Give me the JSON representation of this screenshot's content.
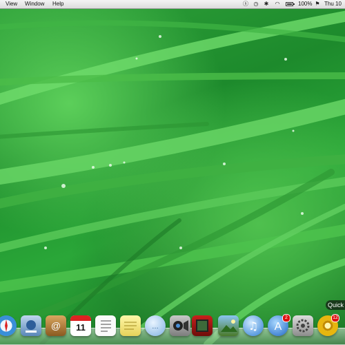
{
  "menubar": {
    "items": [
      "View",
      "Window",
      "Help"
    ],
    "status": {
      "battery_label": "100%",
      "battery_level": 1.0,
      "clock": "Thu 10"
    },
    "icons": [
      "skype-icon",
      "timemachine-icon",
      "bluetooth-icon",
      "wifi-icon",
      "volume-icon",
      "flag-icon"
    ]
  },
  "dock": {
    "items": [
      {
        "name": "safari-icon"
      },
      {
        "name": "preview-icon"
      },
      {
        "name": "address-book-icon"
      },
      {
        "name": "ical-icon",
        "label": "11"
      },
      {
        "name": "textedit-icon"
      },
      {
        "name": "stickies-icon"
      },
      {
        "name": "ichat-icon"
      },
      {
        "name": "facetime-icon"
      },
      {
        "name": "photo-booth-icon"
      },
      {
        "name": "iphoto-icon"
      },
      {
        "name": "itunes-icon"
      },
      {
        "name": "app-store-icon",
        "badge": "2"
      },
      {
        "name": "system-preferences-icon"
      },
      {
        "name": "quicktime-icon",
        "badge": "12"
      }
    ],
    "tooltip": "Quick"
  },
  "colors": {
    "menubar": "#eaeaea",
    "grass_light": "#5ccf5a",
    "grass_dark": "#166f22",
    "badge": "#dd1111"
  }
}
